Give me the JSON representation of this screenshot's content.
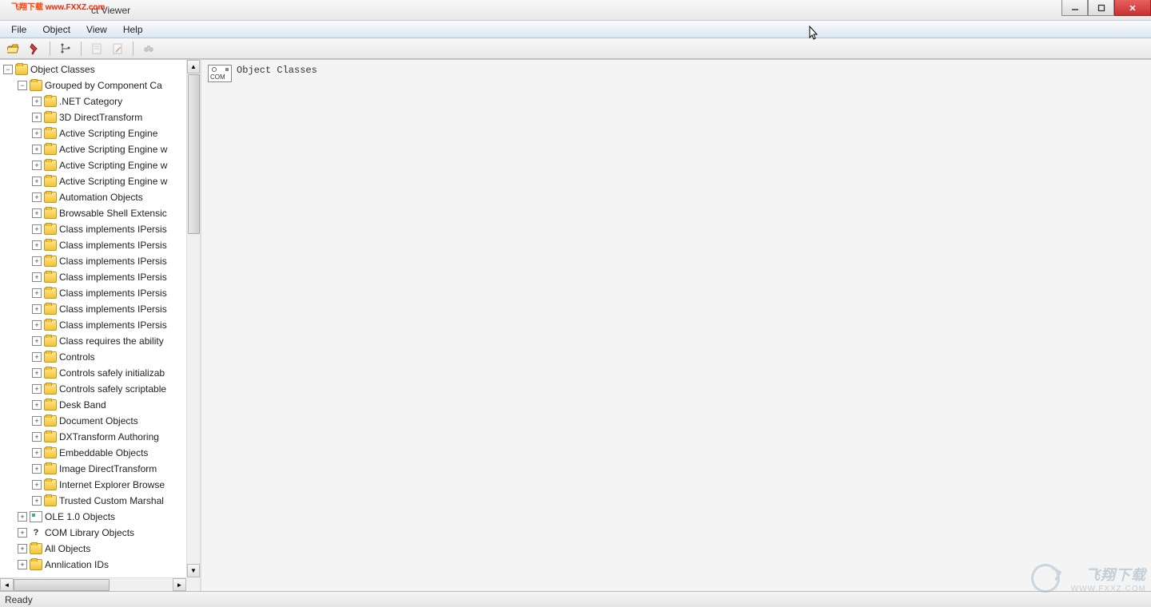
{
  "window": {
    "title": "ct Viewer"
  },
  "watermark_top": {
    "text1": "飞翔下载",
    "text2": "www.FXXZ.com"
  },
  "menubar": {
    "file": "File",
    "object": "Object",
    "view": "View",
    "help": "Help"
  },
  "toolbar": {
    "open": "open-icon",
    "pin": "pin-icon",
    "tree": "tree-icon",
    "doc1": "doc-icon",
    "doc2": "doc-icon",
    "find": "find-icon"
  },
  "tree": {
    "root": "Object Classes",
    "group": "Grouped by Component Ca",
    "children": [
      ".NET Category",
      "3D DirectTransform",
      "Active Scripting Engine",
      "Active Scripting Engine w",
      "Active Scripting Engine w",
      "Active Scripting Engine w",
      "Automation Objects",
      "Browsable Shell Extensic",
      "Class implements IPersis",
      "Class implements IPersis",
      "Class implements IPersis",
      "Class implements IPersis",
      "Class implements IPersis",
      "Class implements IPersis",
      "Class implements IPersis",
      "Class requires the ability",
      "Controls",
      "Controls safely initializab",
      "Controls safely scriptable",
      "Desk Band",
      "Document Objects",
      "DXTransform Authoring",
      "Embeddable Objects",
      "Image DirectTransform",
      "Internet Explorer Browse",
      "Trusted Custom Marshal"
    ],
    "siblings": [
      {
        "label": "OLE 1.0 Objects",
        "icon": "ole"
      },
      {
        "label": "COM Library Objects",
        "icon": "q"
      },
      {
        "label": "All Objects",
        "icon": "folder"
      },
      {
        "label": "Annlication IDs",
        "icon": "folder"
      }
    ]
  },
  "right": {
    "heading": "Object Classes",
    "chip": "COM"
  },
  "status": {
    "text": "Ready"
  },
  "bigwatermark": {
    "line1": "飞翔下载",
    "line2": "WWW.FXXZ.COM"
  }
}
